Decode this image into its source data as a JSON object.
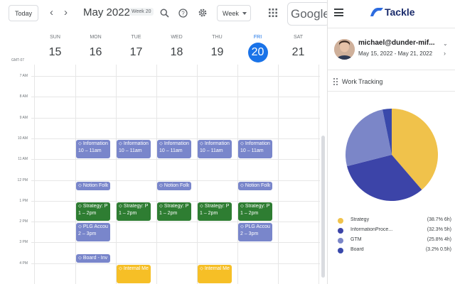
{
  "toolbar": {
    "today_label": "Today",
    "month_title": "May 2022",
    "week_badge": "Week 20",
    "view_select": "Week",
    "google_label": "Google",
    "prev_icon": "chevron-left-icon",
    "next_icon": "chevron-right-icon",
    "search_icon": "search-icon",
    "help_icon": "help-icon",
    "settings_icon": "gear-icon",
    "apps_icon": "apps-grid-icon"
  },
  "timezone": "GMT-07",
  "days": [
    {
      "name": "SUN",
      "num": "15",
      "today": false
    },
    {
      "name": "MON",
      "num": "16",
      "today": false
    },
    {
      "name": "TUE",
      "num": "17",
      "today": false
    },
    {
      "name": "WED",
      "num": "18",
      "today": false
    },
    {
      "name": "THU",
      "num": "19",
      "today": false
    },
    {
      "name": "FRI",
      "num": "20",
      "today": true
    },
    {
      "name": "SAT",
      "num": "21",
      "today": false
    }
  ],
  "hours": [
    "7 AM",
    "8 AM",
    "9 AM",
    "10 AM",
    "11 AM",
    "12 PM",
    "1 PM",
    "2 PM",
    "3 PM",
    "4 PM"
  ],
  "events": [
    {
      "day": 1,
      "start": 10,
      "end": 11,
      "title": "Information",
      "time": "10 – 11am",
      "kind": "info"
    },
    {
      "day": 2,
      "start": 10,
      "end": 11,
      "title": "Information",
      "time": "10 – 11am",
      "kind": "info"
    },
    {
      "day": 3,
      "start": 10,
      "end": 11,
      "title": "Information",
      "time": "10 – 11am",
      "kind": "info"
    },
    {
      "day": 4,
      "start": 10,
      "end": 11,
      "title": "Information",
      "time": "10 – 11am",
      "kind": "info"
    },
    {
      "day": 5,
      "start": 10,
      "end": 11,
      "title": "Information",
      "time": "10 – 11am",
      "kind": "info"
    },
    {
      "day": 1,
      "start": 12,
      "end": 12.5,
      "title": "Notion Follow",
      "time": "",
      "kind": "notion"
    },
    {
      "day": 3,
      "start": 12,
      "end": 12.5,
      "title": "Notion Follow",
      "time": "",
      "kind": "notion"
    },
    {
      "day": 5,
      "start": 12,
      "end": 12.5,
      "title": "Notion Follow",
      "time": "",
      "kind": "notion"
    },
    {
      "day": 1,
      "start": 13,
      "end": 14,
      "title": "Strategy: P",
      "time": "1 – 2pm",
      "kind": "strat"
    },
    {
      "day": 2,
      "start": 13,
      "end": 14,
      "title": "Strategy: P",
      "time": "1 – 2pm",
      "kind": "strat"
    },
    {
      "day": 3,
      "start": 13,
      "end": 14,
      "title": "Strategy: P",
      "time": "1 – 2pm",
      "kind": "strat"
    },
    {
      "day": 4,
      "start": 13,
      "end": 14,
      "title": "Strategy: P",
      "time": "1 – 2pm",
      "kind": "strat"
    },
    {
      "day": 5,
      "start": 13,
      "end": 14,
      "title": "Strategy: P",
      "time": "1 – 2pm",
      "kind": "strat"
    },
    {
      "day": 1,
      "start": 14,
      "end": 15,
      "title": "PLG Accou",
      "time": "2 – 3pm",
      "kind": "plg"
    },
    {
      "day": 5,
      "start": 14,
      "end": 15,
      "title": "PLG Accou",
      "time": "2 – 3pm",
      "kind": "plg"
    },
    {
      "day": 1,
      "start": 15.5,
      "end": 16,
      "title": "Board - Inv",
      "time": "",
      "kind": "board"
    },
    {
      "day": 2,
      "start": 16,
      "end": 17,
      "title": "Internal Me",
      "time": "",
      "kind": "internal"
    },
    {
      "day": 4,
      "start": 16,
      "end": 17,
      "title": "Internal Me",
      "time": "",
      "kind": "internal"
    }
  ],
  "panel": {
    "menu_icon": "menu-icon",
    "logo_text": "Tackle",
    "email": "michael@dunder-mif...",
    "date_range": "May 15, 2022 - May 21, 2022",
    "section_title": "Work Tracking",
    "drag_icon": "drag-handle-icon"
  },
  "chart_data": {
    "type": "pie",
    "title": "",
    "series": [
      {
        "name": "Strategy",
        "value": 38.7,
        "hours": 6,
        "color": "#f0c24b"
      },
      {
        "name": "InformationProce...",
        "value": 32.3,
        "hours": 5,
        "color": "#3c44a8"
      },
      {
        "name": "GTM",
        "value": 25.8,
        "hours": 4,
        "color": "#7b86c8"
      },
      {
        "name": "Board",
        "value": 3.2,
        "hours": 0.5,
        "color": "#3949ab"
      }
    ],
    "legend": [
      {
        "label": "Strategy",
        "value_text": "(38.7% 6h)",
        "color": "#f0c24b"
      },
      {
        "label": "InformationProce...",
        "value_text": "(32.3% 5h)",
        "color": "#3c44a8"
      },
      {
        "label": "GTM",
        "value_text": "(25.8% 4h)",
        "color": "#7b86c8"
      },
      {
        "label": "Board",
        "value_text": "(3.2% 0.5h)",
        "color": "#3949ab"
      }
    ]
  }
}
